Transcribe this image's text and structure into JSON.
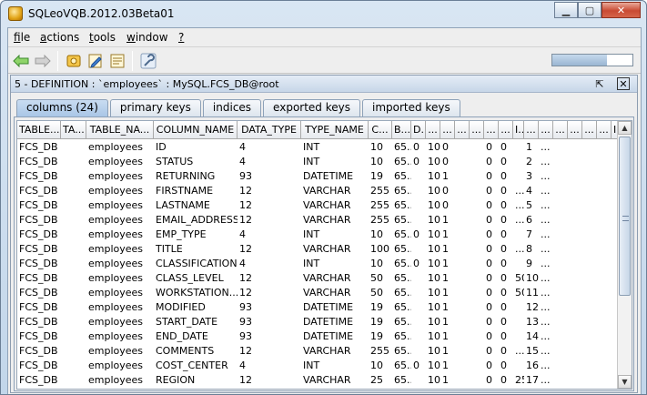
{
  "window": {
    "title": "SQLeoVQB.2012.03Beta01"
  },
  "menu": [
    {
      "key": "f",
      "rest": "ile"
    },
    {
      "key": "a",
      "rest": "ctions"
    },
    {
      "key": "t",
      "rest": "ools"
    },
    {
      "key": "w",
      "rest": "indow"
    },
    {
      "key": "?",
      "rest": ""
    }
  ],
  "toolbar": {
    "buttons": [
      "back-arrow-icon",
      "forward-arrow-icon",
      "connect-icon",
      "edit-query-icon",
      "report-icon",
      "wrench-icon"
    ],
    "progress": 0.68
  },
  "inner": {
    "title": "5 - DEFINITION : `employees` : MySQL.FCS_DB@root",
    "undock_glyph": "⇱",
    "close_glyph": "✕"
  },
  "tabs": [
    "columns (24)",
    "primary keys",
    "indices",
    "exported keys",
    "imported keys"
  ],
  "active_tab": 0,
  "table": {
    "headers": [
      "TABLE...",
      "TA...",
      "TABLE_NA...",
      "COLUMN_NAME",
      "DATA_TYPE",
      "TYPE_NAME",
      "C...",
      "B...",
      "D...",
      "...",
      "...",
      "...",
      "...",
      "...",
      "...",
      "I...",
      "...",
      "...",
      "...",
      "...",
      "...",
      "...",
      "I..."
    ],
    "rows": [
      [
        "FCS_DB",
        "",
        "employees",
        "ID",
        "4",
        "INT",
        "10",
        "65...",
        "0",
        "10",
        "0",
        "",
        "",
        "0",
        "0",
        "",
        "1",
        "...",
        "",
        "",
        "",
        "",
        ""
      ],
      [
        "FCS_DB",
        "",
        "employees",
        "STATUS",
        "4",
        "INT",
        "10",
        "65...",
        "0",
        "10",
        "0",
        "",
        "",
        "0",
        "0",
        "",
        "2",
        "...",
        "",
        "",
        "",
        "",
        ""
      ],
      [
        "FCS_DB",
        "",
        "employees",
        "RETURNING",
        "93",
        "DATETIME",
        "19",
        "65...",
        "",
        "10",
        "1",
        "",
        "",
        "0",
        "0",
        "",
        "3",
        "...",
        "",
        "",
        "",
        "",
        ""
      ],
      [
        "FCS_DB",
        "",
        "employees",
        "FIRSTNAME",
        "12",
        "VARCHAR",
        "255",
        "65...",
        "",
        "10",
        "0",
        "",
        "",
        "0",
        "0",
        "...",
        "4",
        "...",
        "",
        "",
        "",
        "",
        ""
      ],
      [
        "FCS_DB",
        "",
        "employees",
        "LASTNAME",
        "12",
        "VARCHAR",
        "255",
        "65...",
        "",
        "10",
        "0",
        "",
        "",
        "0",
        "0",
        "...",
        "5",
        "...",
        "",
        "",
        "",
        "",
        ""
      ],
      [
        "FCS_DB",
        "",
        "employees",
        "EMAIL_ADDRESS",
        "12",
        "VARCHAR",
        "255",
        "65...",
        "",
        "10",
        "1",
        "",
        "",
        "0",
        "0",
        "...",
        "6",
        "...",
        "",
        "",
        "",
        "",
        ""
      ],
      [
        "FCS_DB",
        "",
        "employees",
        "EMP_TYPE",
        "4",
        "INT",
        "10",
        "65...",
        "0",
        "10",
        "1",
        "",
        "",
        "0",
        "0",
        "",
        "7",
        "...",
        "",
        "",
        "",
        "",
        ""
      ],
      [
        "FCS_DB",
        "",
        "employees",
        "TITLE",
        "12",
        "VARCHAR",
        "100",
        "65...",
        "",
        "10",
        "1",
        "",
        "",
        "0",
        "0",
        "...",
        "8",
        "...",
        "",
        "",
        "",
        "",
        ""
      ],
      [
        "FCS_DB",
        "",
        "employees",
        "CLASSIFICATION",
        "4",
        "INT",
        "10",
        "65...",
        "0",
        "10",
        "1",
        "",
        "",
        "0",
        "0",
        "",
        "9",
        "...",
        "",
        "",
        "",
        "",
        ""
      ],
      [
        "FCS_DB",
        "",
        "employees",
        "CLASS_LEVEL",
        "12",
        "VARCHAR",
        "50",
        "65...",
        "",
        "10",
        "1",
        "",
        "",
        "0",
        "0",
        "50",
        "10",
        "...",
        "",
        "",
        "",
        "",
        ""
      ],
      [
        "FCS_DB",
        "",
        "employees",
        "WORKSTATION...",
        "12",
        "VARCHAR",
        "50",
        "65...",
        "",
        "10",
        "1",
        "",
        "",
        "0",
        "0",
        "50",
        "11",
        "...",
        "",
        "",
        "",
        "",
        ""
      ],
      [
        "FCS_DB",
        "",
        "employees",
        "MODIFIED",
        "93",
        "DATETIME",
        "19",
        "65...",
        "",
        "10",
        "1",
        "",
        "",
        "0",
        "0",
        "",
        "12",
        "...",
        "",
        "",
        "",
        "",
        ""
      ],
      [
        "FCS_DB",
        "",
        "employees",
        "START_DATE",
        "93",
        "DATETIME",
        "19",
        "65...",
        "",
        "10",
        "1",
        "",
        "",
        "0",
        "0",
        "",
        "13",
        "...",
        "",
        "",
        "",
        "",
        ""
      ],
      [
        "FCS_DB",
        "",
        "employees",
        "END_DATE",
        "93",
        "DATETIME",
        "19",
        "65...",
        "",
        "10",
        "1",
        "",
        "",
        "0",
        "0",
        "",
        "14",
        "...",
        "",
        "",
        "",
        "",
        ""
      ],
      [
        "FCS_DB",
        "",
        "employees",
        "COMMENTS",
        "12",
        "VARCHAR",
        "255",
        "65...",
        "",
        "10",
        "1",
        "",
        "",
        "0",
        "0",
        "...",
        "15",
        "...",
        "",
        "",
        "",
        "",
        ""
      ],
      [
        "FCS_DB",
        "",
        "employees",
        "COST_CENTER",
        "4",
        "INT",
        "10",
        "65...",
        "0",
        "10",
        "1",
        "",
        "",
        "0",
        "0",
        "",
        "16",
        "...",
        "",
        "",
        "",
        "",
        ""
      ],
      [
        "FCS_DB",
        "",
        "employees",
        "REGION",
        "12",
        "VARCHAR",
        "25",
        "65...",
        "",
        "10",
        "1",
        "",
        "",
        "0",
        "0",
        "25",
        "17",
        "...",
        "",
        "",
        "",
        "",
        ""
      ]
    ]
  }
}
